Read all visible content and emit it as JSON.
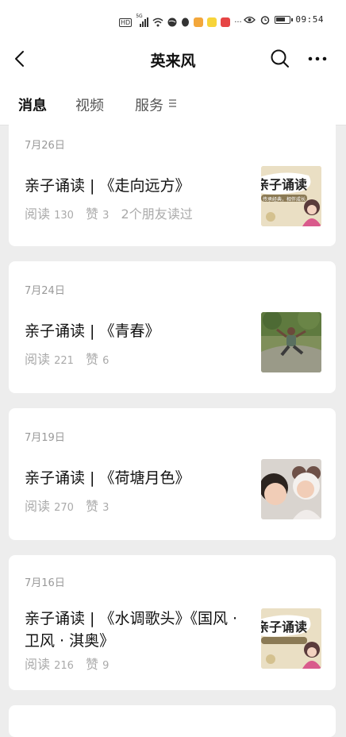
{
  "status_bar": {
    "network_badge": "HD",
    "signal_label": "5G",
    "time": "09:54"
  },
  "header": {
    "title": "英来风"
  },
  "tabs": [
    {
      "label": "消息",
      "active": true
    },
    {
      "label": "视频",
      "active": false
    },
    {
      "label": "服务",
      "active": false
    }
  ],
  "articles": [
    {
      "date": "7月26日",
      "title": "亲子诵读 | 《走向远方》",
      "reads_label": "阅读",
      "reads": "130",
      "likes_label": "赞",
      "likes": "3",
      "friends": "2个朋友读过",
      "thumbnail": {
        "text": "亲子诵读",
        "subtext": "传承经典，相伴成长"
      }
    },
    {
      "date": "7月24日",
      "title": "亲子诵读 | 《青春》",
      "reads_label": "阅读",
      "reads": "221",
      "likes_label": "赞",
      "likes": "6",
      "friends": "",
      "thumbnail": {
        "text": "",
        "subtext": ""
      }
    },
    {
      "date": "7月19日",
      "title": "亲子诵读 | 《荷塘月色》",
      "reads_label": "阅读",
      "reads": "270",
      "likes_label": "赞",
      "likes": "3",
      "friends": "",
      "thumbnail": {
        "text": "",
        "subtext": ""
      }
    },
    {
      "date": "7月16日",
      "title": "亲子诵读 | 《水调歌头》《国风 · 卫风 · 淇奥》",
      "reads_label": "阅读",
      "reads": "216",
      "likes_label": "赞",
      "likes": "9",
      "friends": "",
      "thumbnail": {
        "text": "亲子诵读",
        "subtext": ""
      }
    }
  ],
  "colors": {
    "background": "#ededed",
    "card": "#ffffff",
    "title_text": "#111111",
    "meta_text": "#aaaaaa",
    "thumb_beige": "#e8dcc0",
    "thumb_pink": "#d95a8c"
  },
  "icons": [
    "back-arrow-icon",
    "search-icon",
    "more-dots-icon",
    "menu-lines-icon"
  ]
}
